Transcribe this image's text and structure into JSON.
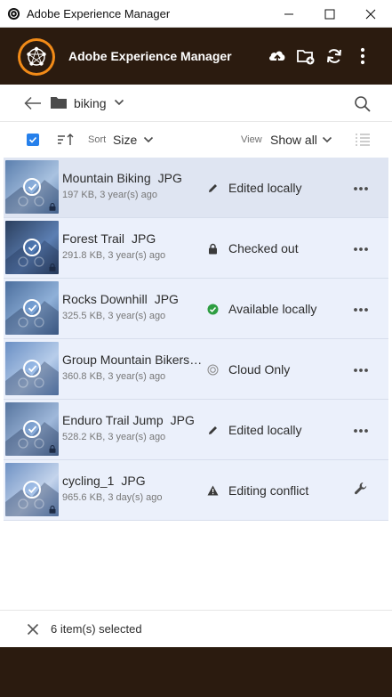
{
  "window": {
    "title": "Adobe Experience Manager",
    "controls": [
      "minimize-icon",
      "maximize-icon",
      "close-icon"
    ]
  },
  "header": {
    "app_name": "Adobe Experience Manager",
    "actions": [
      "upload-icon",
      "new-folder-icon",
      "refresh-icon",
      "more-vertical-icon"
    ],
    "colors": {
      "background": "#2b1b0f",
      "logo_ring": "#f28b18"
    }
  },
  "breadcrumb": {
    "folder": "biking"
  },
  "toolbar": {
    "sort_label": "Sort",
    "sort_value": "Size",
    "view_label": "View",
    "view_value": "Show all"
  },
  "items": [
    {
      "name": "Mountain Biking",
      "type": "JPG",
      "meta": "197 KB, 3 year(s) ago",
      "status": "Edited locally",
      "status_icon": "pencil-icon",
      "action_icon": "more-horizontal-icon",
      "locked": true,
      "thumb": [
        "#5b7fae",
        "#a9c2e0"
      ]
    },
    {
      "name": "Forest Trail",
      "type": "JPG",
      "meta": "291.8 KB, 3 year(s) ago",
      "status": "Checked out",
      "status_icon": "lock-icon",
      "action_icon": "more-horizontal-icon",
      "locked": true,
      "thumb": [
        "#2b3f5e",
        "#5c7fb3"
      ]
    },
    {
      "name": "Rocks Downhill",
      "type": "JPG",
      "meta": "325.5 KB, 3 year(s) ago",
      "status": "Available locally",
      "status_icon": "check-circle-icon",
      "action_icon": "more-horizontal-icon",
      "locked": false,
      "thumb": [
        "#4c6f9e",
        "#8fb0d8"
      ]
    },
    {
      "name": "Group Mountain Bikers",
      "type": "JPG",
      "meta": "360.8 KB, 3 year(s) ago",
      "status": "Cloud Only",
      "status_icon": "cloud-only-icon",
      "action_icon": "more-horizontal-icon",
      "locked": false,
      "thumb": [
        "#6a8fc4",
        "#b7cdea"
      ]
    },
    {
      "name": "Enduro Trail Jump",
      "type": "JPG",
      "meta": "528.2 KB, 3 year(s) ago",
      "status": "Edited locally",
      "status_icon": "pencil-icon",
      "action_icon": "more-horizontal-icon",
      "locked": true,
      "thumb": [
        "#57759f",
        "#9fb8da"
      ]
    },
    {
      "name": "cycling_1",
      "type": "JPG",
      "meta": "965.6 KB, 3 day(s) ago",
      "status": "Editing conflict",
      "status_icon": "alert-icon",
      "action_icon": "wrench-icon",
      "locked": true,
      "thumb": [
        "#6f92c4",
        "#c4d4ec"
      ]
    }
  ],
  "footer": {
    "selection": "6 item(s) selected"
  }
}
